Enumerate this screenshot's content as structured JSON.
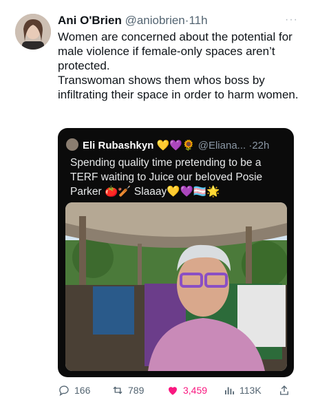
{
  "tweet": {
    "author_name": "Ani O'Brien",
    "author_handle": "@aniobrien",
    "separator": "·",
    "time": "11h",
    "more_label": "···",
    "text_lines": [
      "Women are concerned about the potential for male violence if female-only spaces aren’t protected.",
      "Transwoman shows them whos boss by infiltrating their space in order to harm women."
    ]
  },
  "quote": {
    "author_name": "Eli Rubashkyn",
    "emojis": "💛💜🌻",
    "handle": "@Eliana...",
    "separator": "·",
    "time": "22h",
    "text": "Spending quality time pretending to be a TERF  waiting to Juice our beloved Posie Parker 🍅🏏 Slaaay💛💜🏳️‍⚧️🌟"
  },
  "actions": {
    "replies": "166",
    "retweets": "789",
    "likes": "3,459",
    "views": "113K"
  },
  "colors": {
    "like": "#f91880",
    "muted": "#536471",
    "quote_bg": "#0b0b0b"
  },
  "icons": [
    "reply-icon",
    "retweet-icon",
    "heart-icon",
    "views-icon",
    "share-icon",
    "more-icon"
  ]
}
